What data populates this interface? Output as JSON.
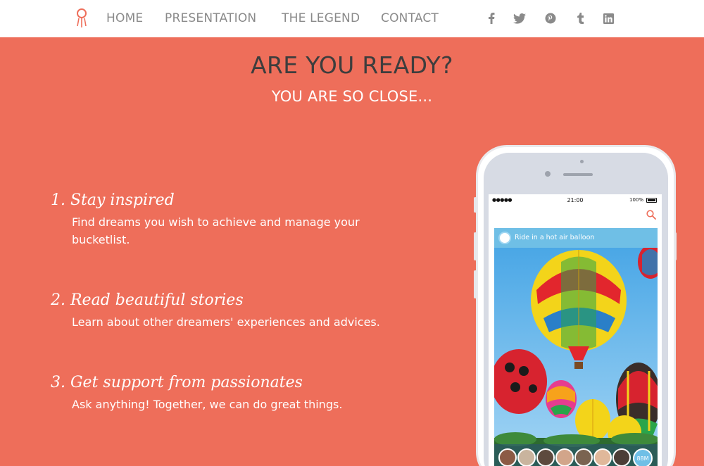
{
  "nav": {
    "logo_icon": "rocket-balloon-icon",
    "links": [
      "HOME",
      "PRESENTATION",
      "THE LEGEND",
      "CONTACT"
    ],
    "social_icons": [
      "facebook-icon",
      "twitter-icon",
      "pinterest-icon",
      "tumblr-icon",
      "linkedin-icon"
    ]
  },
  "hero": {
    "title": "ARE YOU READY?",
    "subtitle": "YOU ARE SO CLOSE..."
  },
  "features": [
    {
      "title": "1.  Stay inspired",
      "description": "Find dreams you wish to achieve and manage your bucketlist."
    },
    {
      "title": "2.  Read beautiful stories",
      "description": "Learn about other dreamers' experiences and advices."
    },
    {
      "title": "3.  Get support from passionates",
      "description": "Ask anything! Together, we can do great things."
    }
  ],
  "phone": {
    "status_signal": "●●●●● ",
    "status_time": "21:00",
    "status_battery": "100%",
    "card_title": "Ride in a hot air balloon",
    "more_count": "88M"
  },
  "colors": {
    "background": "#ee6e5a",
    "nav_background": "#ffffff",
    "title": "#3d3d3d",
    "accent_blue": "#6fbfe6"
  }
}
